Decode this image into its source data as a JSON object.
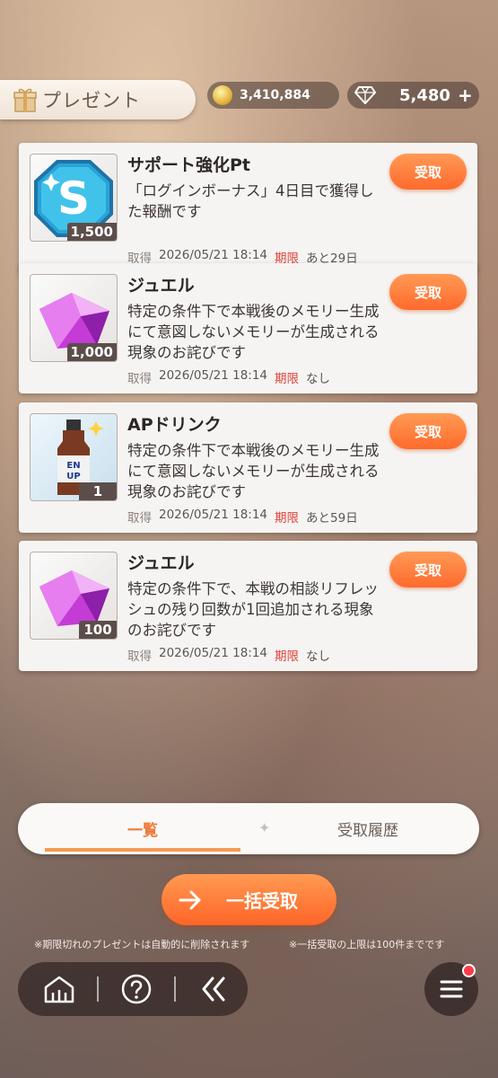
{
  "header": {
    "title": "プレゼント"
  },
  "currency": {
    "coins": "3,410,884",
    "gems": "5,480",
    "gems_add": "+"
  },
  "labels": {
    "acquired": "取得",
    "expiry": "期限",
    "receive": "受取"
  },
  "items": [
    {
      "name": "サポート強化Pt",
      "desc": "「ログインボーナス」4日目で獲得した報酬です",
      "qty": "1,500",
      "acquired": "2026/05/21 18:14",
      "expiry": "あと29日",
      "icon": "support-pt-icon"
    },
    {
      "name": "ジュエル",
      "desc": "特定の条件下で本戦後のメモリー生成にて意図しないメモリーが生成される現象のお詫びです",
      "qty": "1,000",
      "acquired": "2026/05/21 18:14",
      "expiry": "なし",
      "icon": "jewel-icon"
    },
    {
      "name": "APドリンク",
      "desc": "特定の条件下で本戦後のメモリー生成にて意図しないメモリーが生成される現象のお詫びです",
      "qty": "1",
      "acquired": "2026/05/21 18:14",
      "expiry": "あと59日",
      "icon": "ap-drink-icon"
    },
    {
      "name": "ジュエル",
      "desc": "特定の条件下で、本戦の相談リフレッシュの残り回数が1回追加される現象のお詫びです",
      "qty": "100",
      "acquired": "2026/05/21 18:14",
      "expiry": "なし",
      "icon": "jewel-icon"
    }
  ],
  "tabs": {
    "list": "一覧",
    "history": "受取履歴"
  },
  "bulk_receive": "一括受取",
  "notes": {
    "left": "※期限切れのプレゼントは自動的に削除されます",
    "right": "※一括受取の上限は100件までです"
  },
  "colors": {
    "accent": "#ff7a35",
    "expiry": "#e0403a"
  }
}
